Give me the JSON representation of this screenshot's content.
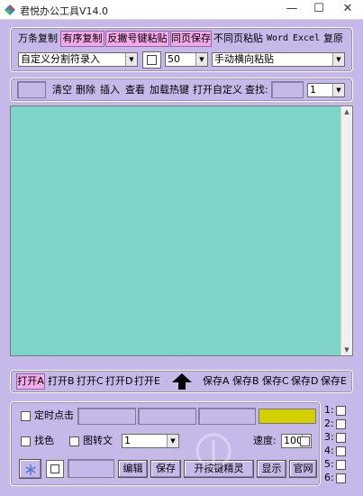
{
  "window": {
    "title": "君悦办公工具V14.0",
    "min_glyph": "—",
    "max_glyph": "☐",
    "close_glyph": "✕"
  },
  "toolbar1": {
    "copy_all": "万条复制",
    "ordered_copy": "有序复制",
    "reverse_paste": "反撇号键粘贴",
    "same_page_save": "同页保存",
    "diff_page_paste": "不同页粘贴",
    "word": "Word",
    "excel": "Excel",
    "restore": "复原",
    "split_mode_select": "自定义分割符录入",
    "count_select": "50",
    "paste_mode_select": "手动横向粘贴"
  },
  "toolbar2": {
    "clear": "清空",
    "delete": "删除",
    "insert": "插入",
    "view": "查看",
    "add_hotkey": "加载热键",
    "open_custom": "打开自定义",
    "find": "查找:",
    "find_index_select": "1"
  },
  "slots": {
    "open_a": "打开A",
    "open_b": "打开B",
    "open_c": "打开C",
    "open_d": "打开D",
    "open_e": "打开E",
    "save_a": "保存A",
    "save_b": "保存B",
    "save_c": "保存C",
    "save_d": "保存D",
    "save_e": "保存E"
  },
  "bottom": {
    "timed_click": "定时点击",
    "find_color": "找色",
    "image_to_text": "图转文",
    "repeat_select": "1",
    "speed_label": "速度:",
    "speed_select": "100",
    "edit": "编辑",
    "save": "保存",
    "open_wizard": "开按键精灵",
    "show": "显示",
    "website": "官网",
    "slots": [
      "1:",
      "2:",
      "3:",
      "4:",
      "5:",
      "6:"
    ]
  },
  "colors": {
    "accent_pink": "#f6a8e8",
    "panel_bg": "#c6b8e8",
    "text_area": "#7fd4c8",
    "color_swatch": "#d4cf00"
  },
  "icons": {
    "up_arrow": "up-arrow-icon",
    "snowflake": "snowflake-icon"
  }
}
